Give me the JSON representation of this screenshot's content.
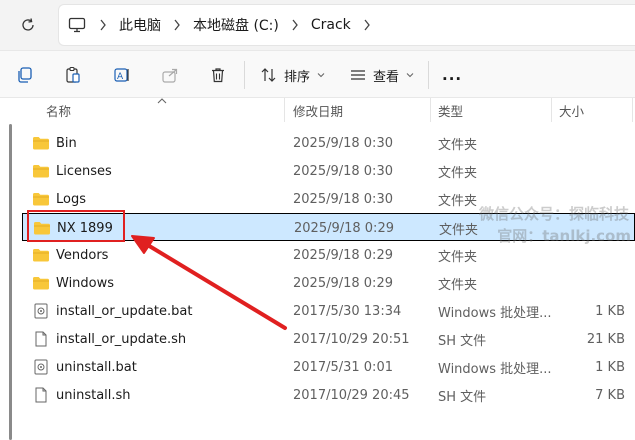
{
  "breadcrumb": {
    "items": [
      "此电脑",
      "本地磁盘 (C:)",
      "Crack"
    ]
  },
  "toolbar": {
    "sort_label": "排序",
    "view_label": "查看",
    "more_label": "..."
  },
  "columns": {
    "name": "名称",
    "modified": "修改日期",
    "type": "类型",
    "size": "大小"
  },
  "files": [
    {
      "name": "Bin",
      "date": "2025/9/18 0:30",
      "type": "文件夹",
      "size": "",
      "kind": "folder"
    },
    {
      "name": "Licenses",
      "date": "2025/9/18 0:30",
      "type": "文件夹",
      "size": "",
      "kind": "folder"
    },
    {
      "name": "Logs",
      "date": "2025/9/18 0:30",
      "type": "文件夹",
      "size": "",
      "kind": "folder"
    },
    {
      "name": "NX 1899",
      "date": "2025/9/18 0:29",
      "type": "文件夹",
      "size": "",
      "kind": "folder"
    },
    {
      "name": "Vendors",
      "date": "2025/9/18 0:29",
      "type": "文件夹",
      "size": "",
      "kind": "folder"
    },
    {
      "name": "Windows",
      "date": "2025/9/18 0:29",
      "type": "文件夹",
      "size": "",
      "kind": "folder"
    },
    {
      "name": "install_or_update.bat",
      "date": "2017/5/30 13:34",
      "type": "Windows 批处理...",
      "size": "1 KB",
      "kind": "bat"
    },
    {
      "name": "install_or_update.sh",
      "date": "2017/10/29 20:51",
      "type": "SH 文件",
      "size": "21 KB",
      "kind": "sh"
    },
    {
      "name": "uninstall.bat",
      "date": "2017/5/31 0:01",
      "type": "Windows 批处理...",
      "size": "1 KB",
      "kind": "bat"
    },
    {
      "name": "uninstall.sh",
      "date": "2017/10/29 20:45",
      "type": "SH 文件",
      "size": "7 KB",
      "kind": "sh"
    }
  ],
  "watermark": {
    "line1": "微信公众号：探临科技",
    "line2": "官网：tanlkj.com"
  },
  "colors": {
    "folder": "#f8c73a",
    "selection": "#cde8ff",
    "annotation": "#e02020"
  }
}
